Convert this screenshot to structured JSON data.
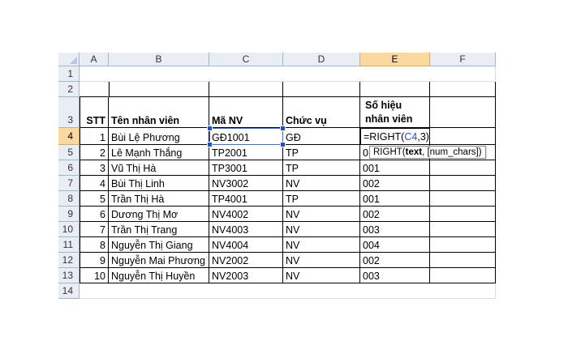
{
  "columns": [
    "A",
    "B",
    "C",
    "D",
    "E",
    "F"
  ],
  "rows": [
    "1",
    "2",
    "3",
    "4",
    "5",
    "6",
    "7",
    "8",
    "9",
    "10",
    "11",
    "12",
    "13",
    "14"
  ],
  "active": {
    "column": "E",
    "row": "4"
  },
  "headers": {
    "stt": "STT",
    "name": "Tên nhân viên",
    "code": "Mã NV",
    "position": "Chức vụ",
    "emp_id": "Số hiệu nhân viên"
  },
  "employees": [
    {
      "stt": "1",
      "name": "Bùi Lệ Phương",
      "code": "GĐ1001",
      "position": "GĐ",
      "emp_id": ""
    },
    {
      "stt": "2",
      "name": "Lê Mạnh Thắng",
      "code": "TP2001",
      "position": "TP",
      "emp_id": "0"
    },
    {
      "stt": "3",
      "name": "Vũ Thị Hà",
      "code": "TP3001",
      "position": "TP",
      "emp_id": "001"
    },
    {
      "stt": "4",
      "name": "Bùi Thị Linh",
      "code": "NV3002",
      "position": "NV",
      "emp_id": "002"
    },
    {
      "stt": "5",
      "name": "Trần Thị Hà",
      "code": "TP4001",
      "position": "TP",
      "emp_id": "001"
    },
    {
      "stt": "6",
      "name": "Dương Thị Mơ",
      "code": "NV4002",
      "position": "NV",
      "emp_id": "002"
    },
    {
      "stt": "7",
      "name": "Trần Thị Trang",
      "code": "NV4003",
      "position": "NV",
      "emp_id": "003"
    },
    {
      "stt": "8",
      "name": "Nguyễn Thị Giang",
      "code": "NV4004",
      "position": "NV",
      "emp_id": "004"
    },
    {
      "stt": "9",
      "name": "Nguyễn Mai Phương",
      "code": "NV2002",
      "position": "NV",
      "emp_id": "002"
    },
    {
      "stt": "10",
      "name": "Nguyễn Thị Huyền",
      "code": "NV2003",
      "position": "NV",
      "emp_id": "003"
    }
  ],
  "formula": {
    "prefix": "=RIGHT(",
    "ref": "C4",
    "suffix": ",3)"
  },
  "tooltip": {
    "func": "RIGHT(",
    "arg1": "text",
    "rest": ", [num_chars])"
  },
  "colors": {
    "header_bg": "#e9eef5",
    "active_header_bg": "#f9d99f",
    "selection": "#3a6ed8",
    "ref_text": "#2b4ccf"
  }
}
